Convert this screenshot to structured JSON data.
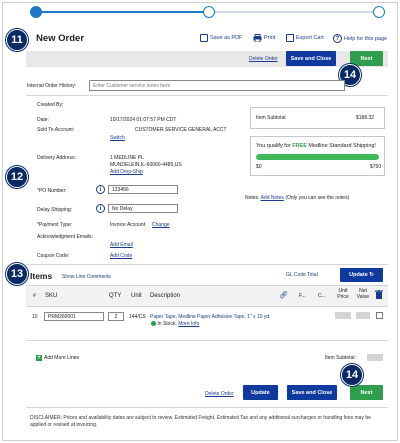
{
  "badges": {
    "b11": "11",
    "b12": "12",
    "b13": "13",
    "b14_top": "14",
    "b14_bottom": "14"
  },
  "header": {
    "title": "New Order",
    "save_pdf": "Save as PDF",
    "print": "Print",
    "export_cart": "Export Cart",
    "help": "Help for this page"
  },
  "action_bar": {
    "delete_order": "Delete Order",
    "save_close": "Save and Close",
    "next": "Next"
  },
  "history": {
    "label": "Internal Order History:",
    "placeholder": "Enter Customer service notes here"
  },
  "details": {
    "created_by_label": "Created By:",
    "date_label": "Date:",
    "date_value": "10/17/2024 01:07:57 PM CDT",
    "sold_to_label": "Sold To Account:",
    "sold_to_value": "CUSTOMER SERVICE GENERAL ACCT",
    "switch": "Switch",
    "delivery_label": "Delivery Address:",
    "delivery_line1": "1 MEDLINE PL",
    "delivery_line2": "MUNDELEIN,IL-60060-4485,US",
    "add_drop_ship": "Add Drop-Ship",
    "po_label": "*PO Number:",
    "po_value": "123456",
    "delay_label": "Delay Shipping:",
    "delay_value": "No Delay",
    "payment_label": "*Payment Type:",
    "payment_value": "Invoice Account",
    "payment_change": "Change",
    "ack_label": "Acknowledgment Emails:",
    "add_email": "Add Email",
    "coupon_label": "Coupon Code:",
    "add_code": "Add Code"
  },
  "summary": {
    "item_subtotal_label": "Item Subtotal",
    "item_subtotal_value": "$188.32",
    "shipping_pre": "You qualify for ",
    "shipping_free": "FREE",
    "shipping_post": " Medline Standard Shipping!",
    "bar_min": "$0",
    "bar_max": "$750",
    "progress_fraction": 1.0,
    "notes_label": "Notes:",
    "add_notes": "Add Notes",
    "notes_hint": " (Only you can see the notes)"
  },
  "items": {
    "title": "Items",
    "show_line_comments": "Show Line Comments",
    "gl_code_total": "GL Code Total",
    "update": "Update",
    "columns": {
      "num": "#",
      "sku": "SKU",
      "qty": "QTY",
      "unit": "Unit",
      "description": "Description",
      "f": "F...",
      "c": "C...",
      "unit_price": "Unit Price",
      "net_value": "Net Value"
    },
    "row": {
      "num": "10",
      "sku": "PRM260001",
      "qty": "2",
      "unit": "144/CS",
      "description": "Paper Tape, Medline Paper Adhesive Tape, 1\" x 10 yd.",
      "stock": "In Stock.",
      "more_info": "More Info"
    },
    "add_more_lines": "Add More Lines",
    "item_subtotal_label": "Item Subtotal:"
  },
  "bottom_actions": {
    "delete_order": "Delete Order",
    "update": "Update",
    "save_close": "Save and Close",
    "next": "Next"
  },
  "disclaimer": "DISCLAIMER: Prices and availability dates are subject to review. Estimated Freight, Estimated Tax and any additional surcharges or handling fees may be applied or revised at invoicing.",
  "colors": {
    "navy": "#0e3a9e",
    "green": "#2e9e4c",
    "badge": "#0a2a66",
    "progress": "#3fb95a"
  }
}
